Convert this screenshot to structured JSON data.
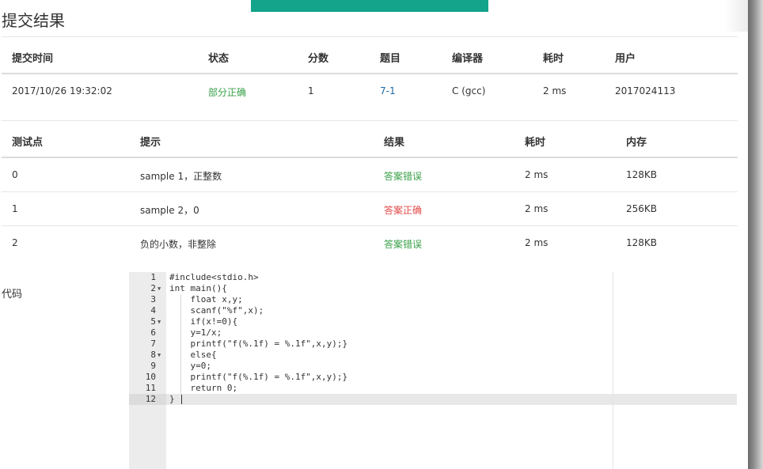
{
  "page": {
    "title": "提交结果"
  },
  "submission": {
    "headers": [
      "提交时间",
      "状态",
      "分数",
      "题目",
      "编译器",
      "耗时",
      "用户"
    ],
    "row": {
      "time": "2017/10/26 19:32:02",
      "status": "部分正确",
      "score": "1",
      "problem": "7-1",
      "compiler": "C (gcc)",
      "elapsed": "2 ms",
      "user": "2017024113"
    }
  },
  "testcases": {
    "headers": [
      "测试点",
      "提示",
      "结果",
      "耗时",
      "内存"
    ],
    "rows": [
      {
        "id": "0",
        "hint": "sample 1，正整数",
        "result": "答案错误",
        "time": "2 ms",
        "memory": "128KB"
      },
      {
        "id": "1",
        "hint": "sample 2，0",
        "result": "答案正确",
        "time": "2 ms",
        "memory": "256KB"
      },
      {
        "id": "2",
        "hint": "负的小数，非整除",
        "result": "答案错误",
        "time": "2 ms",
        "memory": "128KB"
      }
    ]
  },
  "code": {
    "label": "代码",
    "lines": [
      "#include<stdio.h>",
      "int main(){",
      "    float x,y;",
      "    scanf(\"%f\",x);",
      "    if(x!=0){",
      "    y=1/x;",
      "    printf(\"f(%.1f) = %.1f\",x,y);}",
      "    else{",
      "    y=0;",
      "    printf(\"f(%.1f) = %.1f\",x,y);}",
      "    return 0;",
      "}"
    ],
    "line_numbers": [
      "1",
      "2",
      "3",
      "4",
      "5",
      "6",
      "7",
      "8",
      "9",
      "10",
      "11",
      "12"
    ]
  },
  "colors": {
    "toast": "#14a38b",
    "status_partial": "#3aa049",
    "wrong": "#3aa049",
    "correct": "#e24a4a",
    "problem_link": "#1b6aa8"
  }
}
